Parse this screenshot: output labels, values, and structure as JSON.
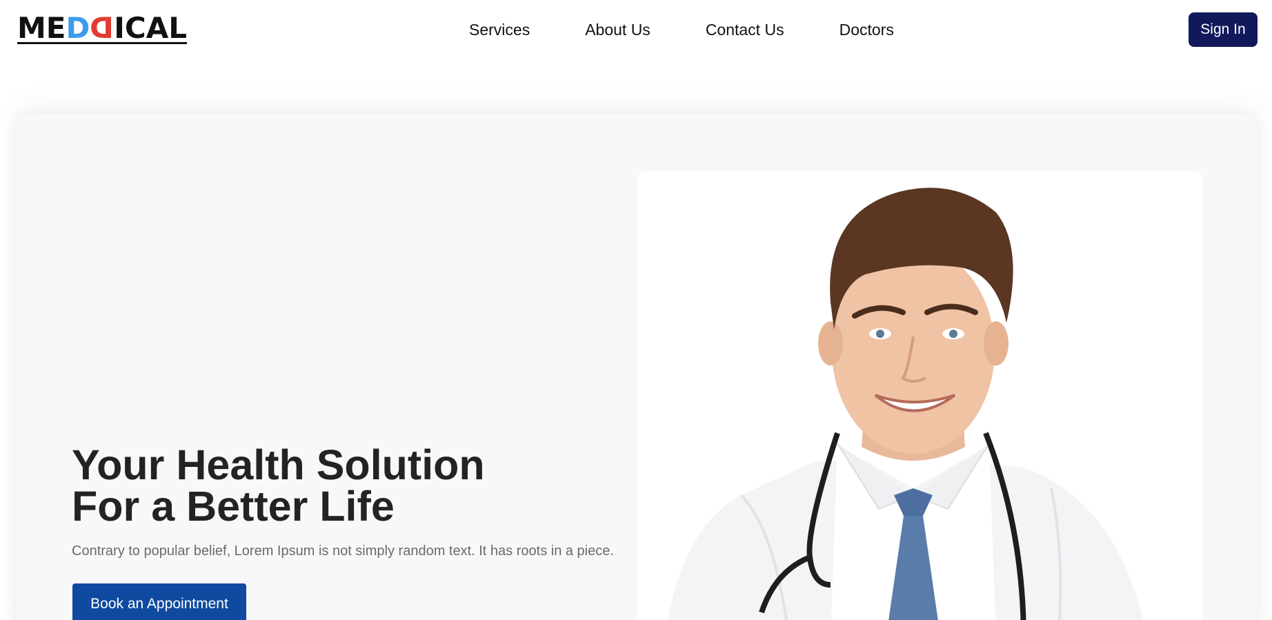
{
  "header": {
    "logo": {
      "part1": "ME",
      "part2": "D",
      "part3": "D",
      "part4": "ICAL"
    },
    "nav": [
      "Services",
      "About Us",
      "Contact Us",
      "Doctors"
    ],
    "signin_label": "Sign In"
  },
  "hero": {
    "title_line1": "Your Health Solution",
    "title_line2": "For a Better Life",
    "description": "Contrary to popular belief, Lorem Ipsum is not simply random text. It has roots in a piece.",
    "cta_label": "Book an Appointment"
  },
  "colors": {
    "brand_dark": "#12195a",
    "cta_blue": "#0f4aa0",
    "logo_blue": "#3d9be9",
    "logo_red": "#e23b33"
  }
}
